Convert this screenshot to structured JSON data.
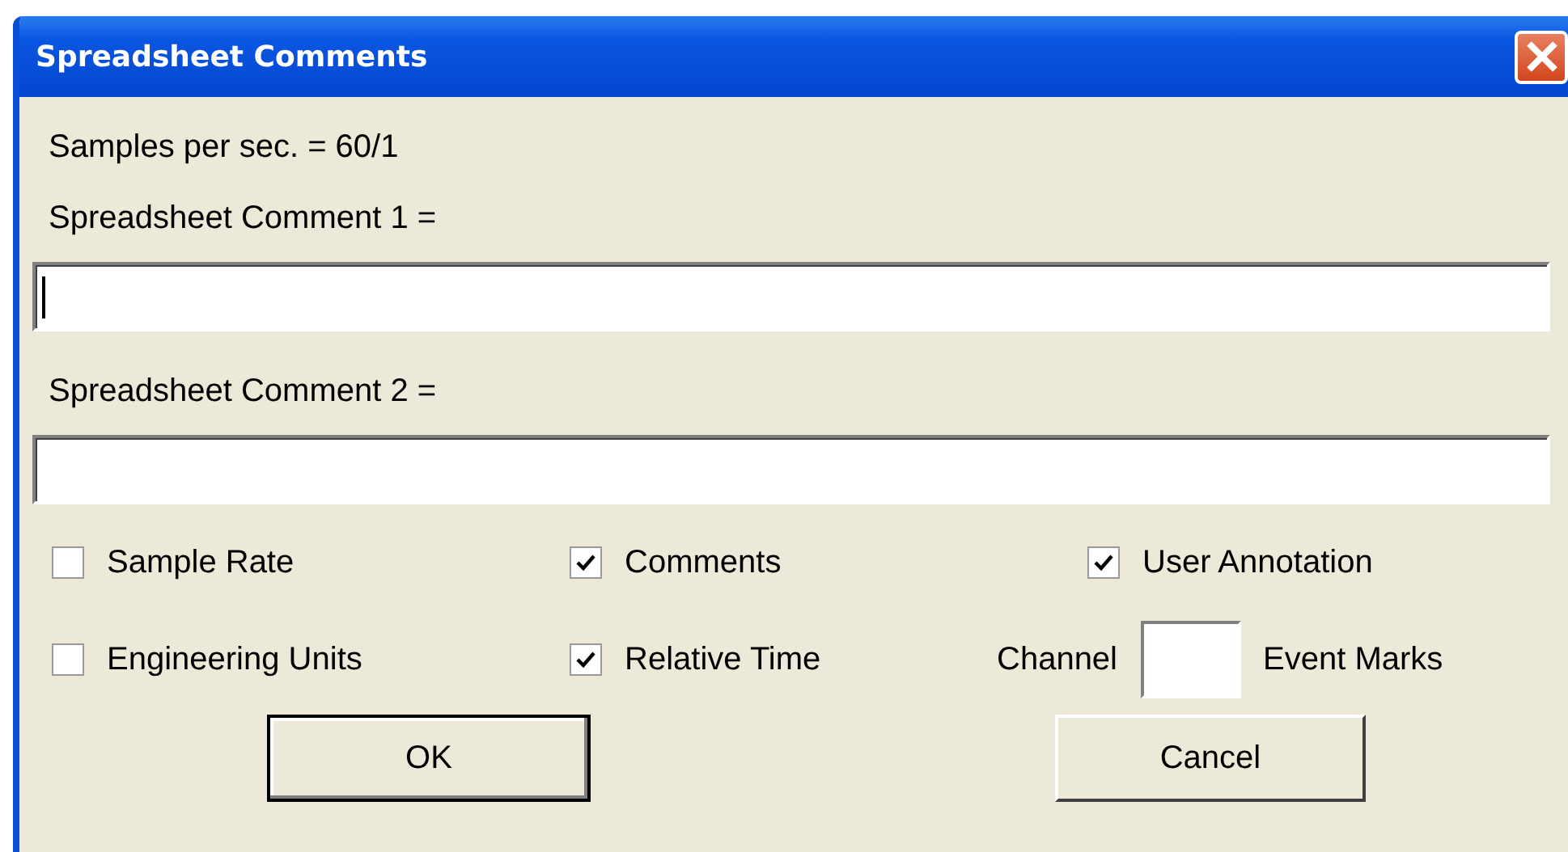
{
  "window": {
    "title": "Spreadsheet Comments"
  },
  "sample_rate": "Samples per sec. = 60/1",
  "comment_fields": [
    {
      "label": "Spreadsheet Comment 1 =",
      "focused": true
    },
    {
      "label": "Spreadsheet Comment 2 =",
      "focused": false
    }
  ],
  "options": [
    {
      "kind": "checkbox",
      "label": "Sample Rate",
      "checked": false
    },
    {
      "kind": "checkbox",
      "label": "Comments",
      "checked": true
    },
    {
      "kind": "checkbox",
      "label": "User Annotation",
      "checked": true
    },
    {
      "kind": "checkbox",
      "label": "Engineering Units",
      "checked": false
    },
    {
      "kind": "checkbox",
      "label": "Relative Time",
      "checked": true
    },
    {
      "kind": "channel",
      "label": "Channel",
      "suffix": "Event Marks"
    }
  ],
  "buttons": [
    "OK",
    "Cancel"
  ]
}
